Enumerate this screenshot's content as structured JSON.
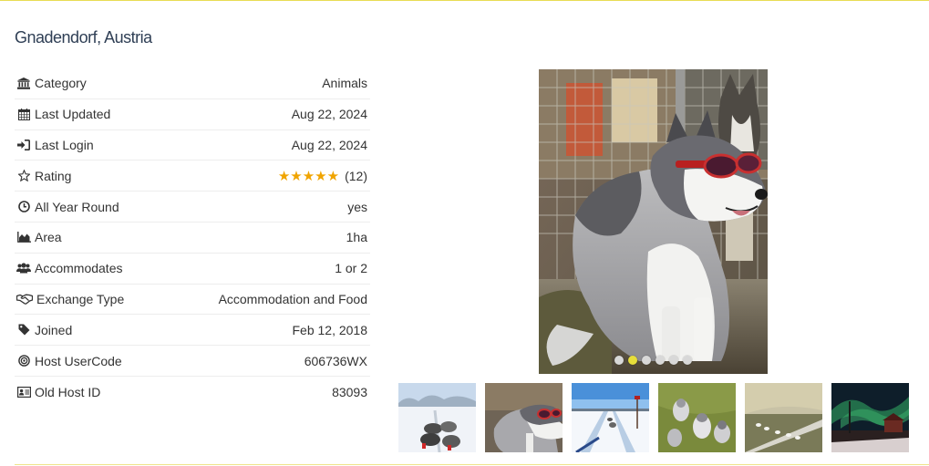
{
  "page": {
    "title": "Gnadendorf, Austria"
  },
  "details": {
    "rows": [
      {
        "icon": "bank-icon",
        "label": "Category",
        "value": "Animals"
      },
      {
        "icon": "calendar-icon",
        "label": "Last Updated",
        "value": "Aug 22, 2024"
      },
      {
        "icon": "sign-in-icon",
        "label": "Last Login",
        "value": "Aug 22, 2024"
      },
      {
        "icon": "star-outline-icon",
        "label": "Rating",
        "value": "(12)",
        "stars": "★★★★★",
        "stars_count": 5
      },
      {
        "icon": "clock-icon",
        "label": "All Year Round",
        "value": "yes"
      },
      {
        "icon": "area-chart-icon",
        "label": "Area",
        "value": "1ha"
      },
      {
        "icon": "users-icon",
        "label": "Accommodates",
        "value": "1 or 2"
      },
      {
        "icon": "handshake-icon",
        "label": "Exchange Type",
        "value": "Accommodation and Food"
      },
      {
        "icon": "tag-icon",
        "label": "Joined",
        "value": "Feb 12, 2018"
      },
      {
        "icon": "bullseye-icon",
        "label": "Host UserCode",
        "value": "606736WX"
      },
      {
        "icon": "id-card-icon",
        "label": "Old Host ID",
        "value": "83093"
      }
    ]
  },
  "gallery": {
    "slide_count": 6,
    "active_slide": 2,
    "colors": {
      "dot_active": "#e6de3a",
      "dot_inactive": "#d8d8d8",
      "star": "#f0a400",
      "rule": "#e8dc55"
    }
  }
}
